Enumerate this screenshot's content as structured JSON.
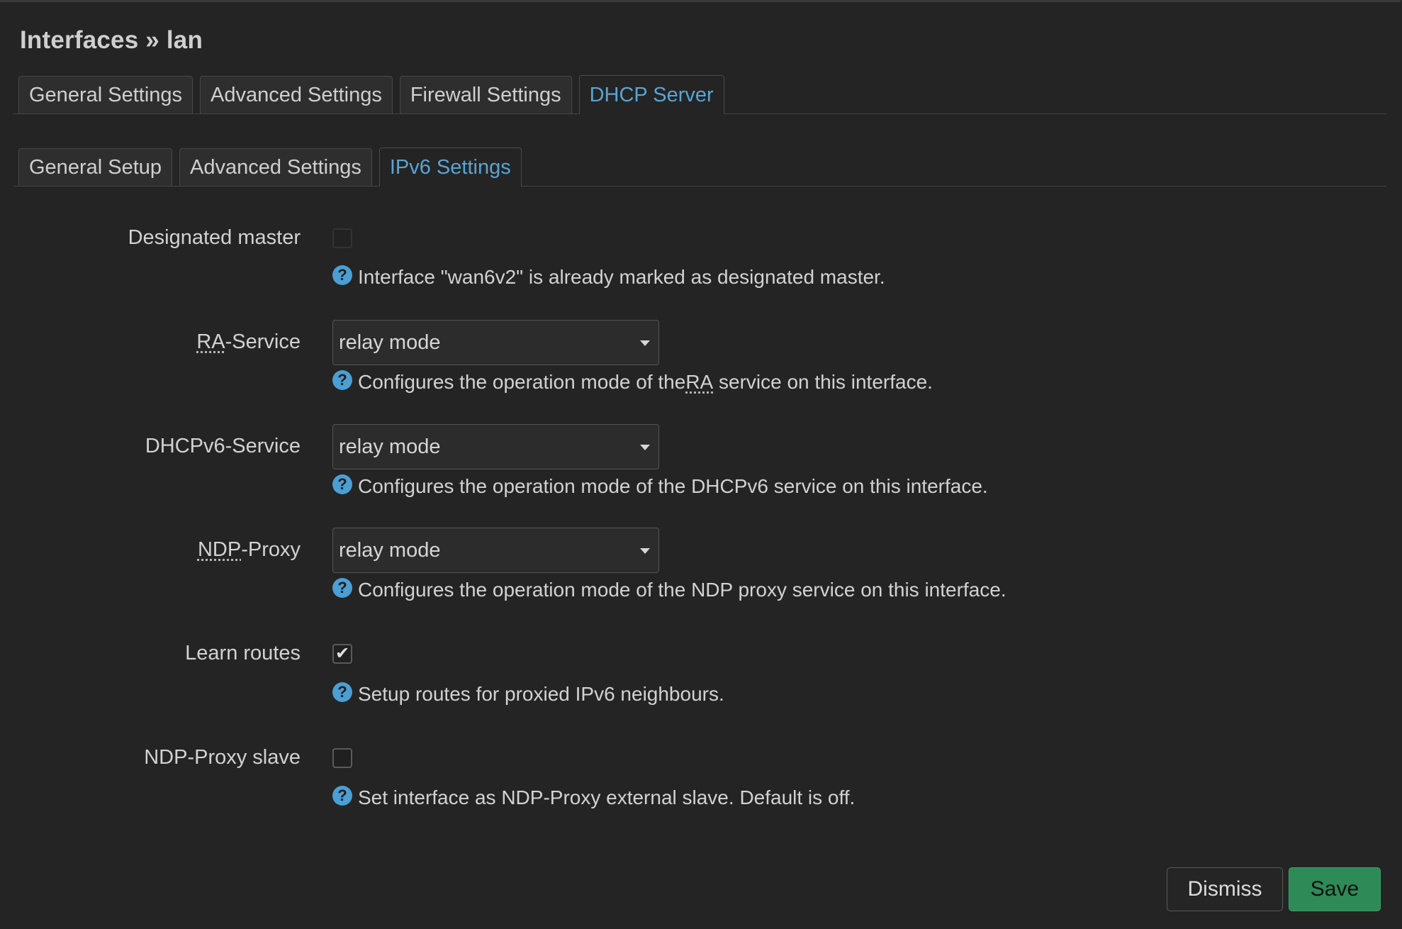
{
  "page": {
    "title": "Interfaces » lan"
  },
  "tabs": [
    {
      "label": "General Settings",
      "active": false
    },
    {
      "label": "Advanced Settings",
      "active": false
    },
    {
      "label": "Firewall Settings",
      "active": false
    },
    {
      "label": "DHCP Server",
      "active": true
    }
  ],
  "subtabs": [
    {
      "label": "General Setup",
      "active": false
    },
    {
      "label": "Advanced Settings",
      "active": false
    },
    {
      "label": "IPv6 Settings",
      "active": true
    }
  ],
  "fields": {
    "designated_master": {
      "label": "Designated master",
      "checked": false,
      "disabled": true,
      "help": "Interface \"wan6v2\" is already marked as designated master."
    },
    "ra_service": {
      "label_abbr": "RA",
      "label_rest": "-Service",
      "value": "relay mode",
      "help_pre": "Configures the operation mode of the ",
      "help_abbr": "RA",
      "help_post": " service on this interface."
    },
    "dhcpv6_service": {
      "label": "DHCPv6-Service",
      "value": "relay mode",
      "help": "Configures the operation mode of the DHCPv6 service on this interface."
    },
    "ndp_proxy": {
      "label_abbr": "NDP",
      "label_rest": "-Proxy",
      "value": "relay mode",
      "help": "Configures the operation mode of the NDP proxy service on this interface."
    },
    "learn_routes": {
      "label": "Learn routes",
      "checked": true,
      "help": "Setup routes for proxied IPv6 neighbours."
    },
    "ndp_proxy_slave": {
      "label": "NDP-Proxy slave",
      "checked": false,
      "help": "Set interface as NDP-Proxy external slave. Default is off."
    }
  },
  "icons": {
    "help": "question-circle-icon",
    "caret": "caret-down-icon",
    "check": "checkmark-icon"
  },
  "help_glyph": "?",
  "check_glyph": "✔",
  "buttons": {
    "dismiss": "Dismiss",
    "save": "Save"
  },
  "colors": {
    "accent": "#5ba4d2",
    "save": "#2e8a57",
    "background": "#242424"
  }
}
